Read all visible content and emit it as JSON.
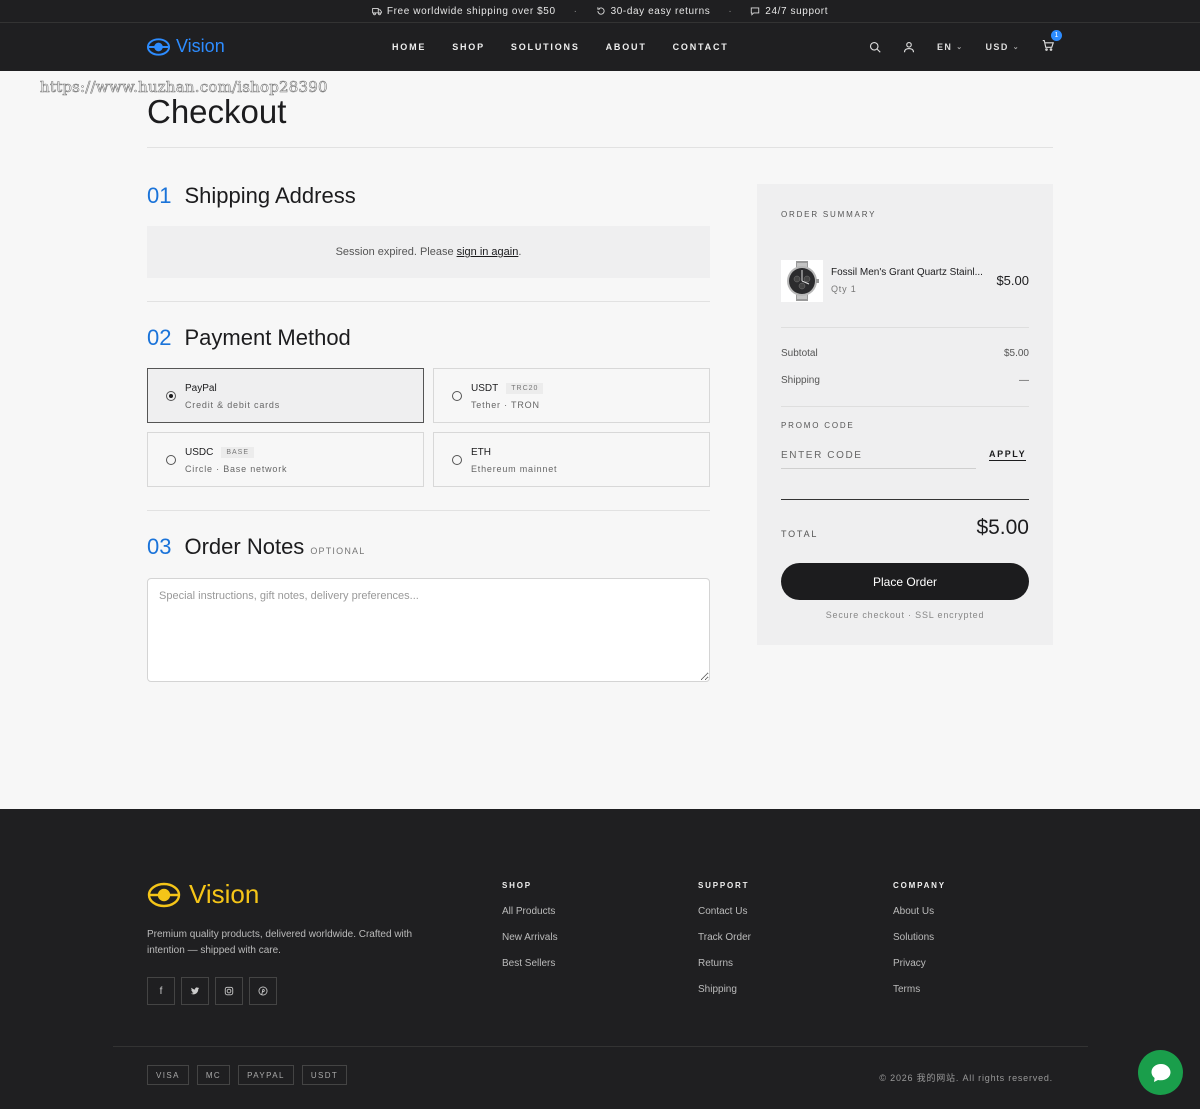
{
  "announcement": {
    "items": [
      {
        "icon": "truck-icon",
        "text": "Free worldwide shipping over $50"
      },
      {
        "icon": "return-icon",
        "text": "30-day easy returns"
      },
      {
        "icon": "chat-icon",
        "text": "24/7 support"
      }
    ],
    "separator": "·"
  },
  "header": {
    "brand": "Vision",
    "brand_color": "#2d8cff",
    "nav": [
      "HOME",
      "SHOP",
      "SOLUTIONS",
      "ABOUT",
      "CONTACT"
    ],
    "language": "EN",
    "currency": "USD",
    "cart_count": "1"
  },
  "watermark": "https://www.huzhan.com/ishop28390",
  "page": {
    "title": "Checkout"
  },
  "shipping": {
    "num": "01",
    "title": "Shipping Address",
    "session_text": "Session expired. Please",
    "session_link": "sign in again",
    "session_end": "."
  },
  "payment": {
    "num": "02",
    "title": "Payment Method",
    "selected": "PayPal",
    "options": [
      {
        "name": "PayPal",
        "tag": "",
        "sub": "Credit & debit cards"
      },
      {
        "name": "USDT",
        "tag": "TRC20",
        "sub": "Tether · TRON"
      },
      {
        "name": "USDC",
        "tag": "BASE",
        "sub": "Circle · Base network"
      },
      {
        "name": "ETH",
        "tag": "",
        "sub": "Ethereum mainnet"
      }
    ]
  },
  "notes": {
    "num": "03",
    "title": "Order Notes",
    "optional": "OPTIONAL",
    "placeholder": "Special instructions, gift notes, delivery preferences..."
  },
  "summary": {
    "label": "ORDER SUMMARY",
    "product": {
      "name": "Fossil Men's Grant Quartz Stainl...",
      "qty": "Qty 1",
      "price": "$5.00"
    },
    "subtotal_label": "Subtotal",
    "subtotal": "$5.00",
    "shipping_label": "Shipping",
    "shipping": "—",
    "promo_label": "PROMO CODE",
    "promo_placeholder": "ENTER CODE",
    "apply": "APPLY",
    "total_label": "TOTAL",
    "total": "$5.00",
    "place_order": "Place Order",
    "secure": "Secure checkout · SSL encrypted"
  },
  "footer": {
    "brand": "Vision",
    "brand_color": "#f5c518",
    "description": "Premium quality products, delivered worldwide. Crafted with intention — shipped with care.",
    "socials": [
      "facebook-icon",
      "twitter-icon",
      "instagram-icon",
      "pinterest-icon"
    ],
    "columns": [
      {
        "title": "SHOP",
        "links": [
          "All Products",
          "New Arrivals",
          "Best Sellers"
        ]
      },
      {
        "title": "SUPPORT",
        "links": [
          "Contact Us",
          "Track Order",
          "Returns",
          "Shipping"
        ]
      },
      {
        "title": "COMPANY",
        "links": [
          "About Us",
          "Solutions",
          "Privacy",
          "Terms"
        ]
      }
    ],
    "payment_badges": [
      "VISA",
      "MC",
      "PAYPAL",
      "USDT"
    ],
    "copyright": "© 2026 我的网站. All rights reserved."
  },
  "colors": {
    "accent": "#1a73d9",
    "dark": "#1f1f21",
    "chat": "#1a9e4b"
  }
}
